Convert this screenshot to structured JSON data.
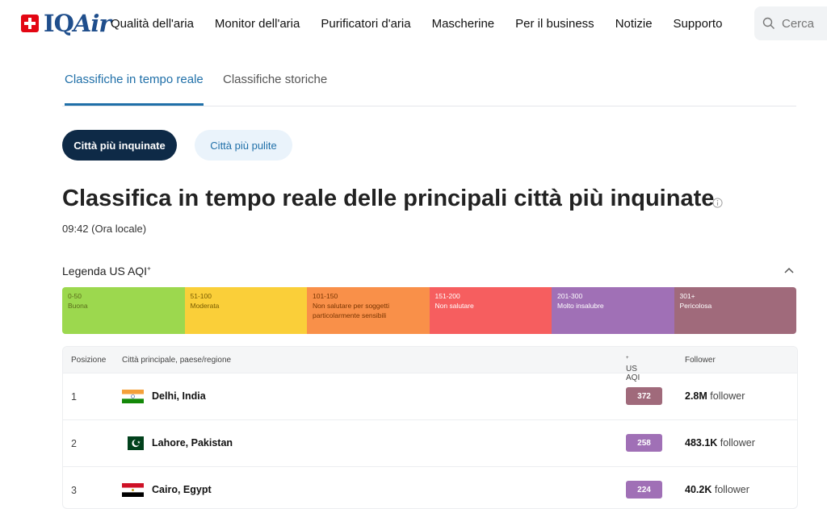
{
  "brand": {
    "name_prefix": "IQ",
    "name_suffix": "Air",
    "accent": "#1f4e8c",
    "cross_color": "#e30613"
  },
  "nav": {
    "items": [
      "Qualità dell'aria",
      "Monitor dell'aria",
      "Purificatori d'aria",
      "Mascherine",
      "Per il business",
      "Notizie",
      "Supporto"
    ]
  },
  "search": {
    "placeholder": "Cerca"
  },
  "tabs": {
    "realtime": "Classifiche in tempo reale",
    "historical": "Classifiche storiche"
  },
  "filters": {
    "most_polluted": "Città più inquinate",
    "cleanest": "Città più pulite"
  },
  "heading": {
    "title": "Classifica in tempo reale delle principali città più inquinate",
    "time": "09:42 (Ora locale)"
  },
  "legend": {
    "title": "Legenda US AQI",
    "title_sup": "+",
    "segments": [
      {
        "range": "0-50",
        "label": "Buona",
        "color": "#9cd84e",
        "text": "#5a6b1a"
      },
      {
        "range": "51-100",
        "label": "Moderata",
        "color": "#facf39",
        "text": "#7a5d00"
      },
      {
        "range": "101-150",
        "label": "Non salutare per soggetti particolarmente sensibili",
        "color": "#f99049",
        "text": "#7a3500"
      },
      {
        "range": "151-200",
        "label": "Non salutare",
        "color": "#f65e5f",
        "text": "#ffffff"
      },
      {
        "range": "201-300",
        "label": "Molto insalubre",
        "color": "#a070b6",
        "text": "#ffffff"
      },
      {
        "range": "301+",
        "label": "Pericolosa",
        "color": "#a06a7b",
        "text": "#ffffff"
      }
    ]
  },
  "table": {
    "headers": {
      "position": "Posizione",
      "city": "Città principale, paese/regione",
      "aqi": "US AQI",
      "aqi_sup": "+",
      "followers": "Follower"
    },
    "rows": [
      {
        "position": "1",
        "city": "Delhi, India",
        "aqi": "372",
        "aqi_color": "#a06a7b",
        "followers_count": "2.8M",
        "followers_label": "follower",
        "flag": "india-flag-icon"
      },
      {
        "position": "2",
        "city": "Lahore, Pakistan",
        "aqi": "258",
        "aqi_color": "#a070b6",
        "followers_count": "483.1K",
        "followers_label": "follower",
        "flag": "pakistan-flag-icon"
      },
      {
        "position": "3",
        "city": "Cairo, Egypt",
        "aqi": "224",
        "aqi_color": "#a070b6",
        "followers_count": "40.2K",
        "followers_label": "follower",
        "flag": "egypt-flag-icon"
      }
    ]
  }
}
